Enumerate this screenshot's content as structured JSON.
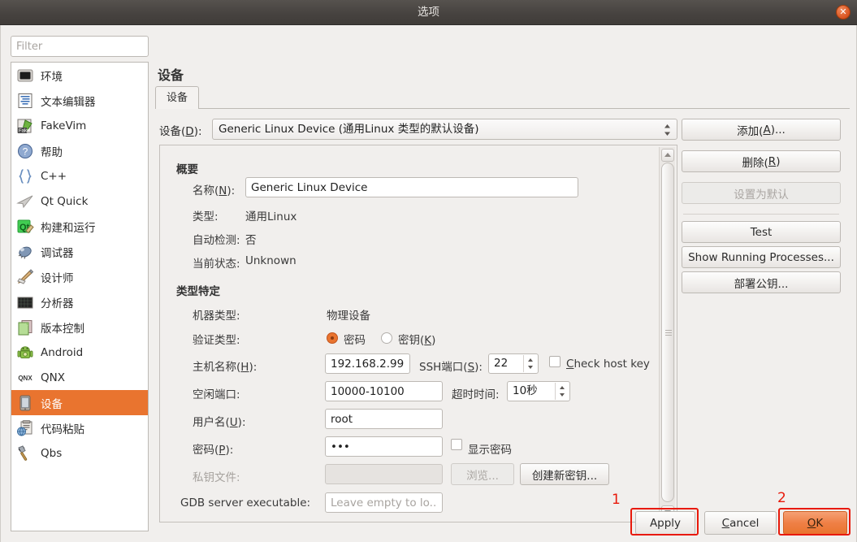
{
  "window": {
    "title": "选项",
    "close_icon": "close-icon"
  },
  "sidebar": {
    "filter_placeholder": "Filter",
    "filter_value": "",
    "items": [
      {
        "label": "环境",
        "icon": "environment-icon",
        "selected": false
      },
      {
        "label": "文本编辑器",
        "icon": "text-editor-icon",
        "selected": false
      },
      {
        "label": "FakeVim",
        "icon": "fakevim-icon",
        "selected": false
      },
      {
        "label": "帮助",
        "icon": "help-icon",
        "selected": false
      },
      {
        "label": "C++",
        "icon": "braces-icon",
        "selected": false
      },
      {
        "label": "Qt Quick",
        "icon": "qtquick-icon",
        "selected": false
      },
      {
        "label": "构建和运行",
        "icon": "build-run-icon",
        "selected": false
      },
      {
        "label": "调试器",
        "icon": "debugger-icon",
        "selected": false
      },
      {
        "label": "设计师",
        "icon": "designer-icon",
        "selected": false
      },
      {
        "label": "分析器",
        "icon": "analyzer-icon",
        "selected": false
      },
      {
        "label": "版本控制",
        "icon": "version-control-icon",
        "selected": false
      },
      {
        "label": "Android",
        "icon": "android-icon",
        "selected": false
      },
      {
        "label": "QNX",
        "icon": "qnx-icon",
        "selected": false
      },
      {
        "label": "设备",
        "icon": "device-icon",
        "selected": true
      },
      {
        "label": "代码粘贴",
        "icon": "code-paste-icon",
        "selected": false
      },
      {
        "label": "Qbs",
        "icon": "qbs-icon",
        "selected": false
      }
    ]
  },
  "page": {
    "title": "设备",
    "tab_label": "设备"
  },
  "device_selector": {
    "label": "设备(D):",
    "label_text": "设备(",
    "label_accel": "D",
    "label_tail": "):",
    "value": "Generic Linux Device (通用Linux 类型的默认设备)"
  },
  "overview": {
    "heading": "概要",
    "name_label_text": "名称(",
    "name_label_accel": "N",
    "name_label_tail": "):",
    "name_value": "Generic Linux Device",
    "type_label": "类型:",
    "type_value": "通用Linux",
    "autodetect_label": "自动检测:",
    "autodetect_value": "否",
    "status_label": "当前状态:",
    "status_value": "Unknown"
  },
  "type_specific": {
    "heading": "类型特定",
    "machine_type_label": "机器类型:",
    "machine_type_value": "物理设备",
    "auth_type_label": "验证类型:",
    "auth_password_label": "密码",
    "auth_key_label_text": "密钥(",
    "auth_key_accel": "K",
    "auth_key_tail": ")",
    "auth_selected": "password",
    "host_label_text": "主机名称(",
    "host_label_accel": "H",
    "host_label_tail": "):",
    "host_value": "192.168.2.99",
    "ssh_port_label_text": "SSH端口(",
    "ssh_port_accel": "S",
    "ssh_port_tail": "):",
    "ssh_port_value": "22",
    "check_host_key_text": "heck host key",
    "check_host_key_accel": "C",
    "check_host_key_checked": false,
    "free_ports_label": "空闲端口:",
    "free_ports_value": "10000-10100",
    "timeout_label": "超时时间:",
    "timeout_value": "10秒",
    "username_label_text": "用户名(",
    "username_accel": "U",
    "username_tail": "):",
    "username_value": "root",
    "password_label_text": "密码(",
    "password_accel": "P",
    "password_tail": "):",
    "password_value": "•••",
    "show_password_label": "显示密码",
    "show_password_checked": false,
    "private_key_label": "私钥文件:",
    "private_key_value": "",
    "browse_button": "浏览...",
    "create_key_button": "创建新密钥...",
    "gdb_label": "GDB server executable:",
    "gdb_placeholder": "Leave empty to lo..."
  },
  "side_buttons": [
    {
      "name": "add",
      "label_text": "添加(",
      "accel": "A",
      "label_tail": ")...",
      "disabled": false
    },
    {
      "name": "remove",
      "label_text": "删除(",
      "accel": "R",
      "label_tail": ")",
      "disabled": false
    },
    {
      "name": "set-default",
      "label_text": "设置为默认",
      "accel": "",
      "label_tail": "",
      "disabled": true
    },
    {
      "name": "test",
      "label_text": "Test",
      "accel": "",
      "label_tail": "",
      "disabled": false
    },
    {
      "name": "show-running-processes",
      "label_text": "Show Running Processes...",
      "accel": "",
      "label_tail": "",
      "disabled": false
    },
    {
      "name": "deploy-public-key",
      "label_text": "部署公钥...",
      "accel": "",
      "label_tail": "",
      "disabled": false
    }
  ],
  "footer": {
    "apply_label": "Apply",
    "cancel_label_text": "ancel",
    "cancel_accel": "C",
    "ok_label_text": "K",
    "ok_accel": "O"
  },
  "annotations": [
    {
      "number": "1",
      "target": "apply-button"
    },
    {
      "number": "2",
      "target": "ok-button"
    }
  ],
  "colors": {
    "accent": "#e9742f",
    "titlebar": "#474340",
    "annotation": "#e8190a",
    "background": "#f1efed"
  }
}
